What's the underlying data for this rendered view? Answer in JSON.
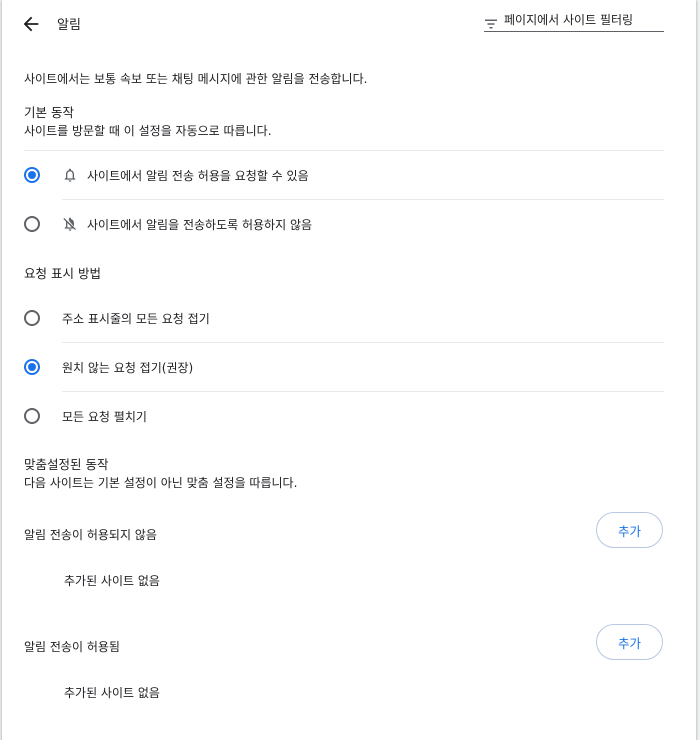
{
  "header": {
    "back_icon": "arrow-back-icon",
    "title": "알림",
    "search_icon": "filter-icon",
    "search_placeholder": "페이지에서 사이트 필터링"
  },
  "description": "사이트에서는 보통 속보 또는 채팅 메시지에 관한 알림을 전송합니다.",
  "default_behavior": {
    "title": "기본 동작",
    "subtitle": "사이트를 방문할 때 이 설정을 자동으로 따릅니다.",
    "options": [
      {
        "label": "사이트에서 알림 전송 허용을 요청할 수 있음",
        "icon": "bell-icon",
        "checked": true
      },
      {
        "label": "사이트에서 알림을 전송하도록 허용하지 않음",
        "icon": "bell-off-icon",
        "checked": false
      }
    ]
  },
  "request_display": {
    "title": "요청 표시 방법",
    "options": [
      {
        "label": "주소 표시줄의 모든 요청 접기",
        "checked": false
      },
      {
        "label": "원치 않는 요청 접기(권장)",
        "checked": true
      },
      {
        "label": "모든 요청 펼치기",
        "checked": false
      }
    ]
  },
  "custom_behavior": {
    "title": "맞춤설정된 동작",
    "subtitle": "다음 사이트는 기본 설정이 아닌 맞춤 설정을 따릅니다.",
    "groups": [
      {
        "title": "알림 전송이 허용되지 않음",
        "add_label": "추가",
        "empty_text": "추가된 사이트 없음"
      },
      {
        "title": "알림 전송이 허용됨",
        "add_label": "추가",
        "empty_text": "추가된 사이트 없음"
      }
    ]
  },
  "colors": {
    "accent": "#1a73e8",
    "text": "#202124",
    "icon": "#5f6368",
    "divider": "#e8eaed"
  }
}
